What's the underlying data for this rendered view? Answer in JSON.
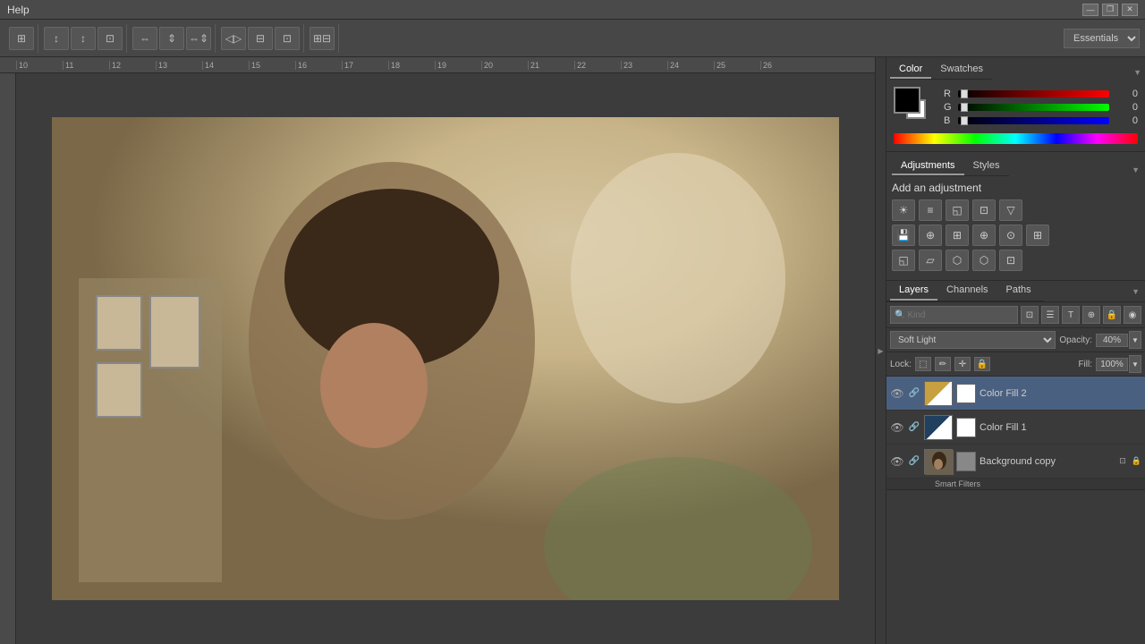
{
  "titleBar": {
    "title": "Help",
    "minBtn": "—",
    "maxBtn": "❒",
    "closeBtn": "✕"
  },
  "toolbar": {
    "essentials": "Essentials",
    "buttons": [
      "⊞",
      "↕",
      "↕",
      "⊡",
      "⇔",
      "⇕",
      "⇔⇕",
      "◁▷",
      "◁▷",
      "◁▷",
      "⊞⊟"
    ]
  },
  "colorPanel": {
    "tabs": [
      "Color",
      "Swatches"
    ],
    "activeTab": "Color",
    "rLabel": "R",
    "gLabel": "G",
    "bLabel": "B",
    "rValue": "0",
    "gValue": "0",
    "bValue": "0"
  },
  "adjustmentsPanel": {
    "tabs": [
      "Adjustments",
      "Styles"
    ],
    "activeTab": "Adjustments",
    "title": "Add an adjustment",
    "icons": [
      "☀",
      "≡≡",
      "◱",
      "⊡",
      "▽",
      "💾",
      "⊕",
      "⊞",
      "⊕",
      "⊙",
      "⊞",
      "◱",
      "▱",
      "⬡",
      "⬡",
      "⊡"
    ]
  },
  "layersPanel": {
    "tabs": [
      "Layers",
      "Channels",
      "Paths"
    ],
    "activeTab": "Layers",
    "searchPlaceholder": "Kind",
    "blendMode": "Soft Light",
    "opacityLabel": "Opacity:",
    "opacityValue": "40%",
    "lockLabel": "Lock:",
    "fillLabel": "Fill:",
    "fillValue": "100%",
    "layers": [
      {
        "name": "Color Fill 2",
        "visible": true,
        "thumbType": "color-fill2",
        "maskColor": "#ffffff",
        "active": true
      },
      {
        "name": "Color Fill 1",
        "visible": true,
        "thumbType": "color-fill1",
        "maskColor": "#ffffff",
        "active": false
      },
      {
        "name": "Background copy",
        "visible": true,
        "thumbType": "bg",
        "maskColor": "#888888",
        "active": false,
        "hasEffects": true,
        "effectsLabel": "Smart Filters"
      }
    ]
  },
  "ruler": {
    "numbers": [
      "10",
      "11",
      "12",
      "13",
      "14",
      "15",
      "16",
      "17",
      "18",
      "19",
      "20",
      "21",
      "22",
      "23",
      "24",
      "25",
      "26"
    ]
  }
}
